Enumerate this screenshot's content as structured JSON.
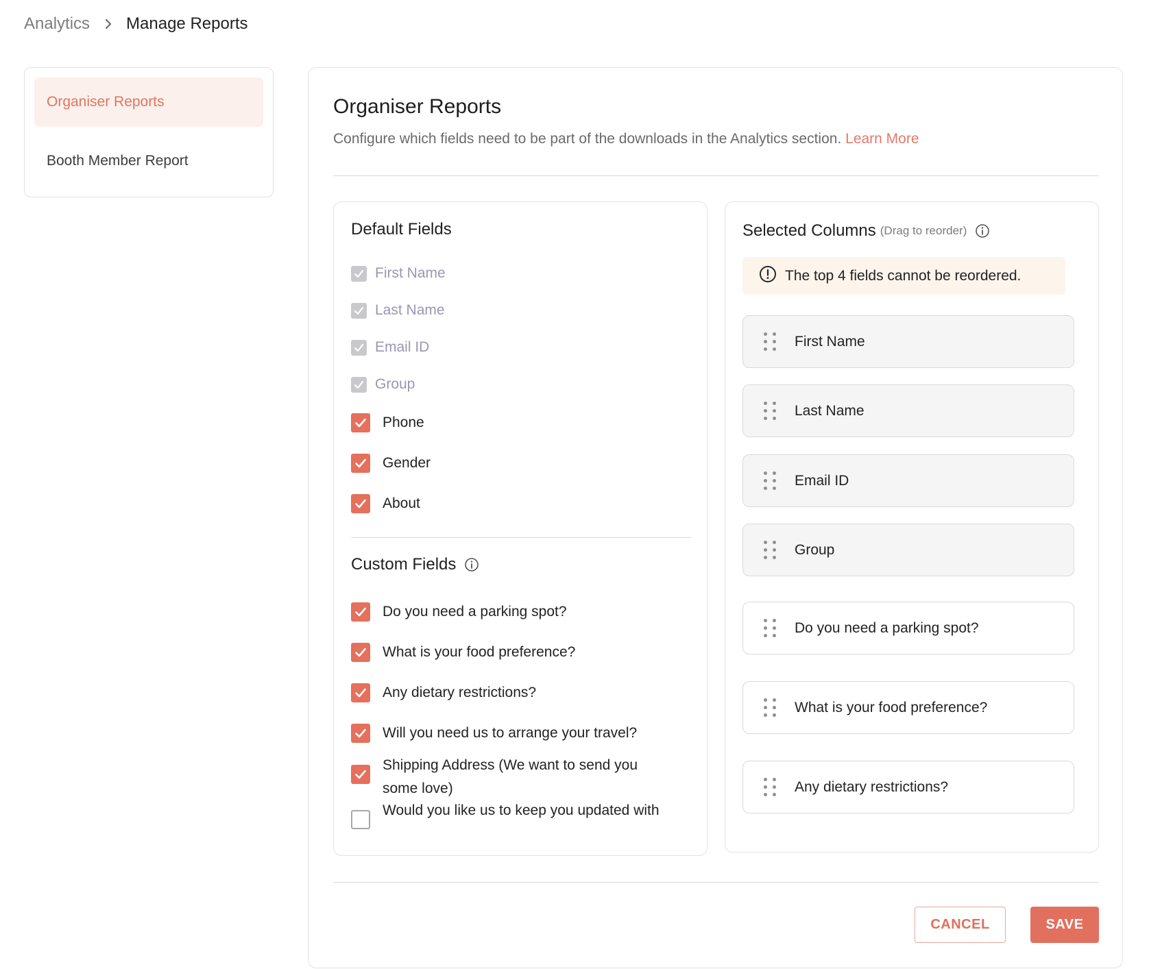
{
  "breadcrumb": {
    "parent": "Analytics",
    "current": "Manage Reports"
  },
  "sidebar": {
    "items": [
      {
        "label": "Organiser Reports",
        "active": true
      },
      {
        "label": "Booth Member Report",
        "active": false
      }
    ]
  },
  "page": {
    "title": "Organiser Reports",
    "description": "Configure which fields need to be part of the downloads in the Analytics section.",
    "learn_more": "Learn More"
  },
  "default_fields": {
    "title": "Default Fields",
    "items": [
      {
        "label": "First Name",
        "state": "checked-disabled"
      },
      {
        "label": "Last Name",
        "state": "checked-disabled"
      },
      {
        "label": "Email ID",
        "state": "checked-disabled"
      },
      {
        "label": "Group",
        "state": "checked-disabled"
      },
      {
        "label": "Phone",
        "state": "checked"
      },
      {
        "label": "Gender",
        "state": "checked"
      },
      {
        "label": "About",
        "state": "checked"
      }
    ]
  },
  "custom_fields": {
    "title": "Custom Fields",
    "items": [
      {
        "label": "Do you need a parking spot?",
        "state": "checked"
      },
      {
        "label": "What is your food preference?",
        "state": "checked"
      },
      {
        "label": "Any dietary restrictions?",
        "state": "checked"
      },
      {
        "label": "Will you need us to arrange your travel?",
        "state": "checked"
      },
      {
        "label": "Shipping Address (We want to send you some love)",
        "state": "checked"
      },
      {
        "label": "Would you like us to keep you updated with",
        "state": "unchecked"
      }
    ]
  },
  "selected_columns": {
    "title": "Selected Columns",
    "hint": "(Drag to reorder)",
    "notice": "The top 4 fields cannot be reordered.",
    "items": [
      {
        "label": "First Name",
        "locked": true
      },
      {
        "label": "Last Name",
        "locked": true
      },
      {
        "label": "Email ID",
        "locked": true
      },
      {
        "label": "Group",
        "locked": true
      },
      {
        "label": "Do you need a parking spot?",
        "locked": false
      },
      {
        "label": "What is your food preference?",
        "locked": false
      },
      {
        "label": "Any dietary restrictions?",
        "locked": false
      }
    ]
  },
  "actions": {
    "cancel": "CANCEL",
    "save": "SAVE"
  },
  "colors": {
    "accent": "#e5705c",
    "accent_light": "#fcf0ec",
    "notice_bg": "#fdf4ec",
    "disabled_text": "#9a96b3"
  }
}
